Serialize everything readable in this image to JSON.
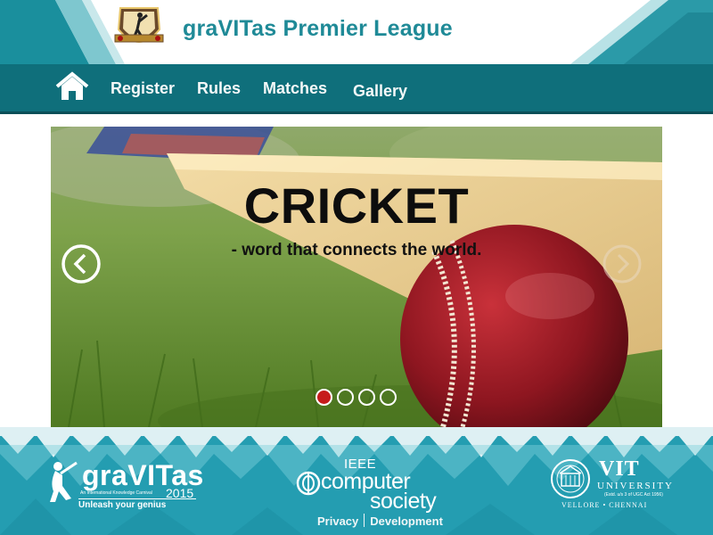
{
  "header": {
    "title": "graVITas Premier League"
  },
  "nav": {
    "home_icon": "home-icon",
    "items": [
      {
        "label": "Register"
      },
      {
        "label": "Rules"
      },
      {
        "label": "Matches"
      },
      {
        "label": "Gallery"
      }
    ]
  },
  "carousel": {
    "title": "CRICKET",
    "subtitle": "- word that connects the world.",
    "prev_icon": "chevron-left-circle-icon",
    "next_icon": "chevron-right-circle-icon",
    "slide_count": 4,
    "active_slide": 1
  },
  "footer": {
    "gravitas": {
      "word": "graVITas",
      "small_text": "An International Knowledge Carnival",
      "year": "2015",
      "tagline": "Unleash your genius"
    },
    "ieee": {
      "top": "IEEE",
      "line1": "computer",
      "line2": "society"
    },
    "links": [
      {
        "label": "Privacy"
      },
      {
        "label": "Development"
      }
    ],
    "vit": {
      "name": "VIT",
      "university": "UNIVERSITY",
      "est": "(Estd. u/s 3 of UGC Act 1956)",
      "locations": [
        "VELLORE",
        "CHENNAI"
      ]
    }
  },
  "colors": {
    "teal_title": "#1f8a97",
    "nav_bg": "#0f6f7b",
    "footer_bg": "#2aa0b3",
    "active_dot": "#c61c1c"
  }
}
